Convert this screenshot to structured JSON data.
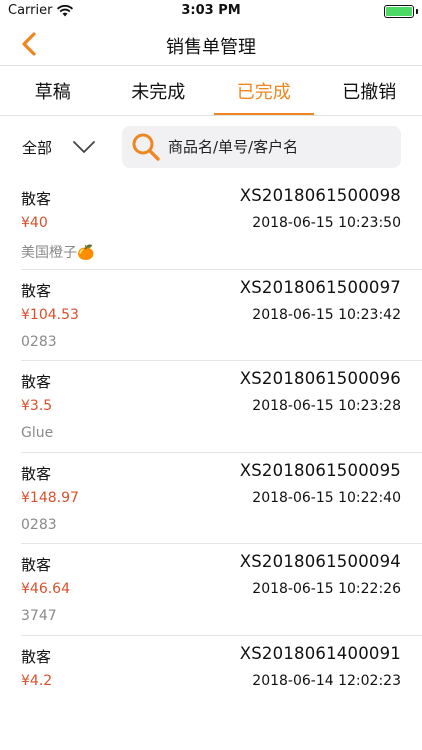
{
  "status_bar": {
    "carrier": "Carrier",
    "time": "3:03 PM"
  },
  "nav": {
    "title": "销售单管理",
    "back_icon": "chevron-left-icon"
  },
  "tabs": [
    {
      "label": "草稿",
      "active": false
    },
    {
      "label": "未完成",
      "active": false
    },
    {
      "label": "已完成",
      "active": true
    },
    {
      "label": "已撤销",
      "active": false
    }
  ],
  "filter": {
    "selected": "全部"
  },
  "search": {
    "placeholder": "商品名/单号/客户名",
    "value": ""
  },
  "colors": {
    "accent": "#f0861f",
    "amount": "#d9502c",
    "muted": "#8a8a8a",
    "divider": "#e4e4e4"
  },
  "orders": [
    {
      "customer": "散客",
      "amount": "¥40",
      "note": "美国橙子🍊",
      "order_no": "XS2018061500098",
      "datetime": "2018-06-15 10:23:50"
    },
    {
      "customer": "散客",
      "amount": "¥104.53",
      "note": "0283",
      "order_no": "XS2018061500097",
      "datetime": "2018-06-15 10:23:42"
    },
    {
      "customer": "散客",
      "amount": "¥3.5",
      "note": "Glue",
      "order_no": "XS2018061500096",
      "datetime": "2018-06-15 10:23:28"
    },
    {
      "customer": "散客",
      "amount": "¥148.97",
      "note": "0283",
      "order_no": "XS2018061500095",
      "datetime": "2018-06-15 10:22:40"
    },
    {
      "customer": "散客",
      "amount": "¥46.64",
      "note": "3747",
      "order_no": "XS2018061500094",
      "datetime": "2018-06-15 10:22:26"
    },
    {
      "customer": "散客",
      "amount": "¥4.2",
      "note": "",
      "order_no": "XS2018061400091",
      "datetime": "2018-06-14 12:02:23"
    }
  ]
}
